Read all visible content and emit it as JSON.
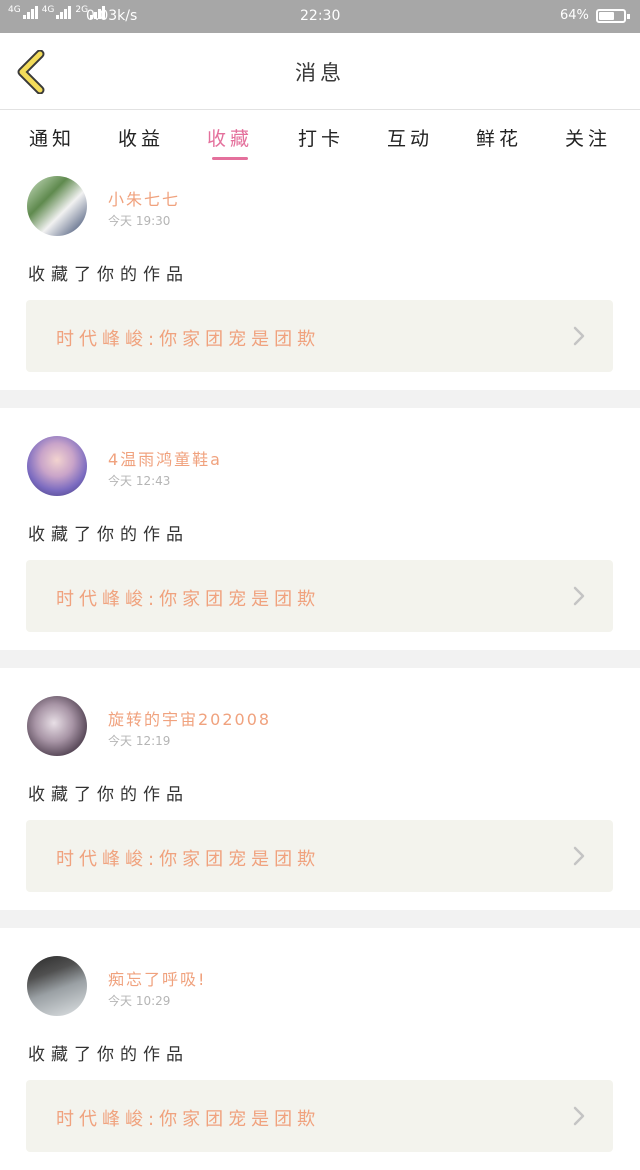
{
  "status_bar": {
    "signal_1": "4G",
    "signal_2": "4G",
    "signal_3": "2G",
    "net_speed": "0.03k/s",
    "time": "22:30",
    "battery": "64%",
    "battery_level": 0.64
  },
  "header": {
    "title": "消息",
    "back_icon": "chevron-left-icon"
  },
  "tabs": [
    {
      "label": "通知",
      "active": false
    },
    {
      "label": "收益",
      "active": false
    },
    {
      "label": "收藏",
      "active": true
    },
    {
      "label": "打卡",
      "active": false
    },
    {
      "label": "互动",
      "active": false
    },
    {
      "label": "鲜花",
      "active": false
    },
    {
      "label": "关注",
      "active": false
    }
  ],
  "colors": {
    "accent": "#e4709c",
    "name": "#f0a27e",
    "card_bg": "#f3f3ed",
    "status_bar": "#a7a7a7"
  },
  "messages": [
    {
      "user": "小朱七七",
      "time": "今天 19:30",
      "action": "收藏了你的作品",
      "work_title": "时代峰峻:你家团宠是团欺"
    },
    {
      "user": "4温雨鸿童鞋a",
      "time": "今天 12:43",
      "action": "收藏了你的作品",
      "work_title": "时代峰峻:你家团宠是团欺"
    },
    {
      "user": "旋转的宇宙202008",
      "time": "今天 12:19",
      "action": "收藏了你的作品",
      "work_title": "时代峰峻:你家团宠是团欺"
    },
    {
      "user": "痴忘了呼吸!",
      "time": "今天 10:29",
      "action": "收藏了你的作品",
      "work_title": "时代峰峻:你家团宠是团欺"
    }
  ]
}
